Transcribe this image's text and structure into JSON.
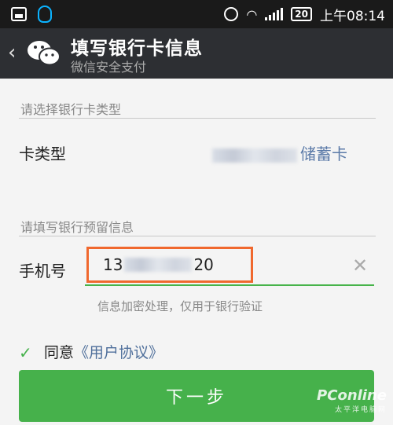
{
  "status_bar": {
    "battery": "20",
    "time": "上午08:14"
  },
  "header": {
    "back_icon": "‹",
    "title": "填写银行卡信息",
    "subtitle": "微信安全支付"
  },
  "card_section": {
    "section_label": "请选择银行卡类型",
    "type_label": "卡类型",
    "type_value": "储蓄卡"
  },
  "info_section": {
    "section_label": "请填写银行预留信息",
    "phone_label": "手机号",
    "phone_prefix": "13",
    "phone_suffix": "20",
    "clear_icon": "✕",
    "hint": "信息加密处理，仅用于银行验证"
  },
  "agreement": {
    "checked": true,
    "check_glyph": "✓",
    "text": "同意",
    "link": "《用户协议》"
  },
  "next_button": {
    "label": "下一步"
  },
  "watermark": {
    "main": "PConline",
    "sub": "太平洋电脑网"
  },
  "colors": {
    "accent_green": "#46b14b",
    "highlight_orange": "#f0682e",
    "link_blue": "#4f6f9b"
  }
}
